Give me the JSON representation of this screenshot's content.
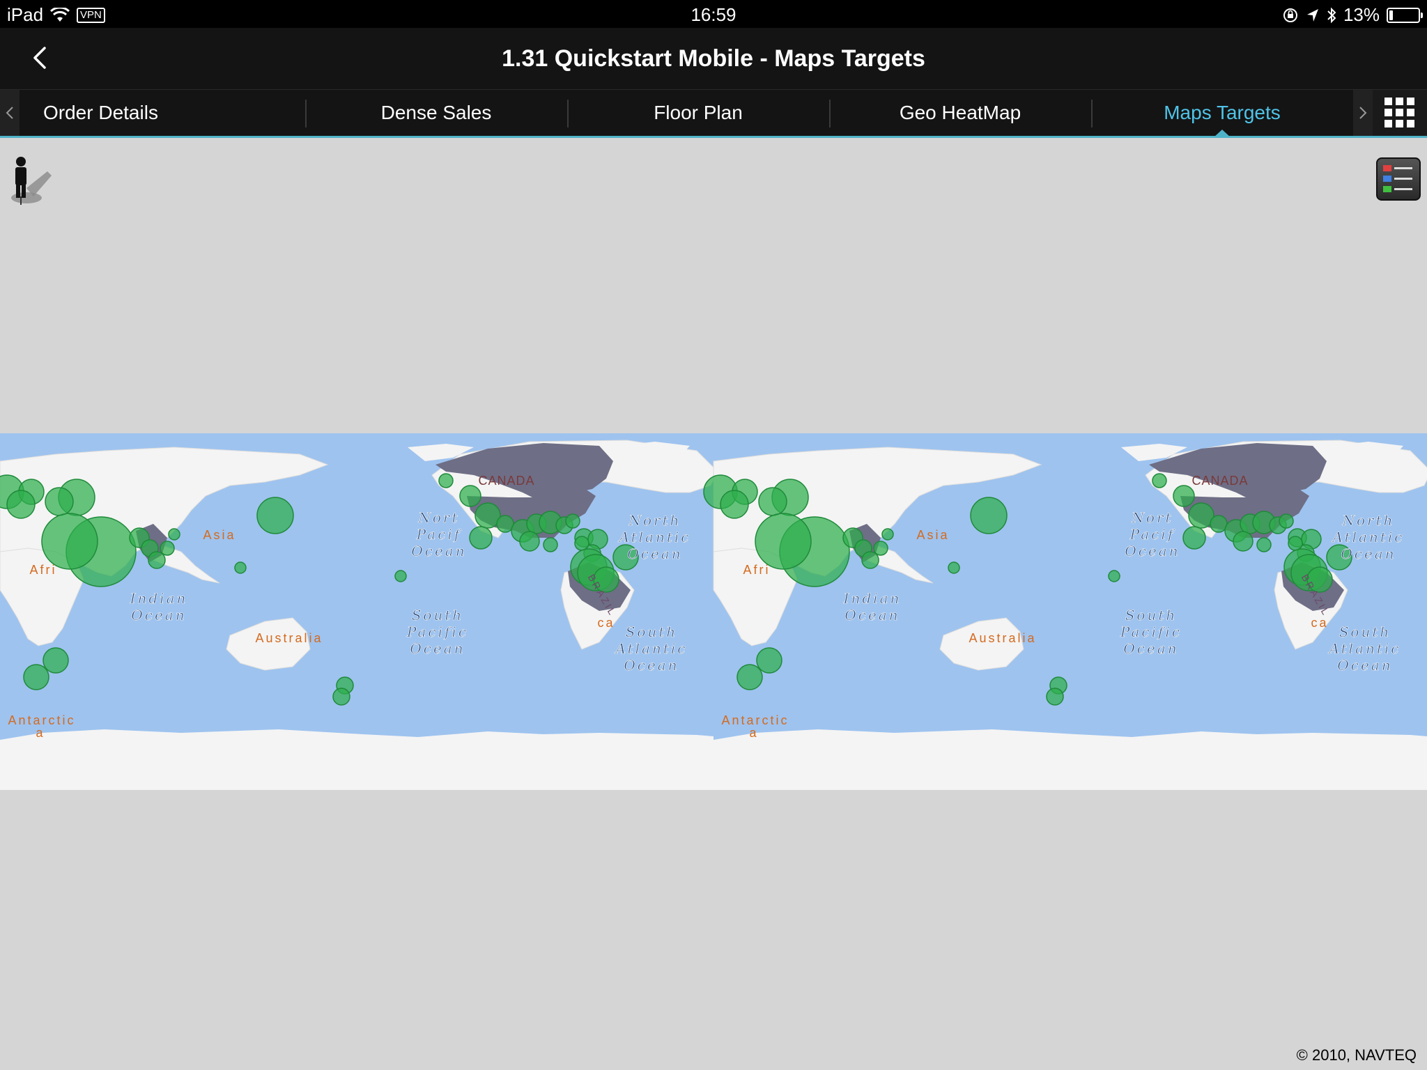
{
  "status": {
    "device": "iPad",
    "vpn": "VPN",
    "time": "16:59",
    "battery": "13%",
    "battery_level": 0.13
  },
  "nav": {
    "title": "1.31 Quickstart Mobile - Maps Targets"
  },
  "tabs": [
    {
      "label": "Order Details",
      "active": false
    },
    {
      "label": "Dense Sales",
      "active": false
    },
    {
      "label": "Floor Plan",
      "active": false
    },
    {
      "label": "Geo HeatMap",
      "active": false
    },
    {
      "label": "Maps Targets",
      "active": true
    }
  ],
  "map": {
    "labels": {
      "canada": "CANADA",
      "asia": "Asia",
      "africa": "Afri",
      "north_pacific": [
        "Nort",
        "Pacif",
        "Ocean"
      ],
      "north_atlantic": [
        "North",
        "Atlantic",
        "Ocean"
      ],
      "indian": [
        "Indian",
        "Ocean"
      ],
      "south_pacific": [
        "South",
        "Pacific",
        "Ocean"
      ],
      "australia": "Australia",
      "brazil": "BRAZIL",
      "south_atlantic": [
        "South",
        "Atlantic",
        "Ocean"
      ],
      "america_frag": "ca",
      "antarctica": [
        "Antarctic",
        "a"
      ]
    },
    "colors": {
      "ocean": "#9ec3ef",
      "land": "#f4f4f4",
      "highlight": "#6e6e86",
      "marker": "#2eaf4c"
    }
  },
  "copyright": "© 2010, NAVTEQ"
}
